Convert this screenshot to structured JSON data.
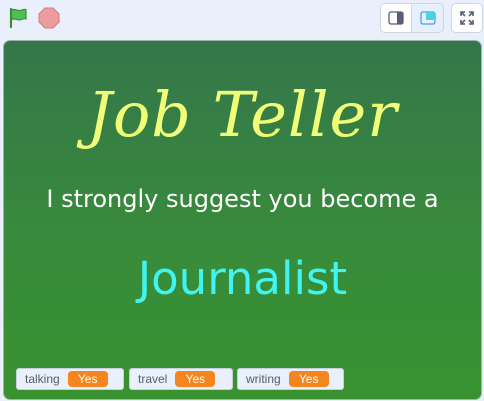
{
  "toolbar": {
    "green_flag_icon": "green-flag-icon",
    "stop_icon": "stop-icon",
    "small_stage_icon": "small-stage-icon",
    "large_stage_icon": "large-stage-icon",
    "fullscreen_icon": "fullscreen-icon"
  },
  "stage": {
    "title": "Job Teller",
    "subtitle": "I strongly suggest you become a",
    "answer": "Journalist"
  },
  "monitors": [
    {
      "label": "talking",
      "value": "Yes"
    },
    {
      "label": "travel",
      "value": "Yes"
    },
    {
      "label": "writing",
      "value": "Yes"
    }
  ],
  "colors": {
    "title": "#f1ff78",
    "answer": "#3ff4f1",
    "monitor_value": "#f5861f",
    "stage_top": "#35764a",
    "stage_bottom": "#39922f"
  }
}
